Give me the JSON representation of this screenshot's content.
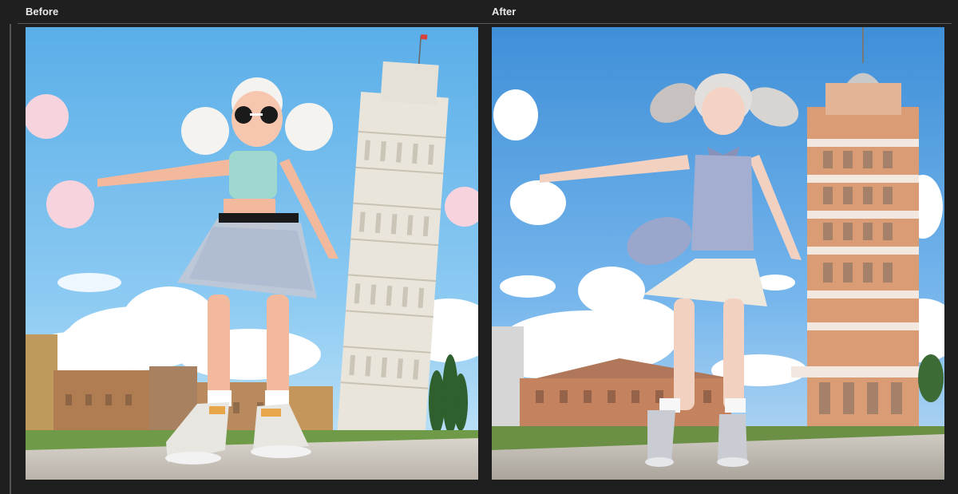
{
  "comparison": {
    "before_label": "Before",
    "after_label": "After"
  },
  "colors": {
    "background": "#1e1e1e",
    "label_text": "#e8e8e8",
    "divider": "#5a5a5a"
  }
}
